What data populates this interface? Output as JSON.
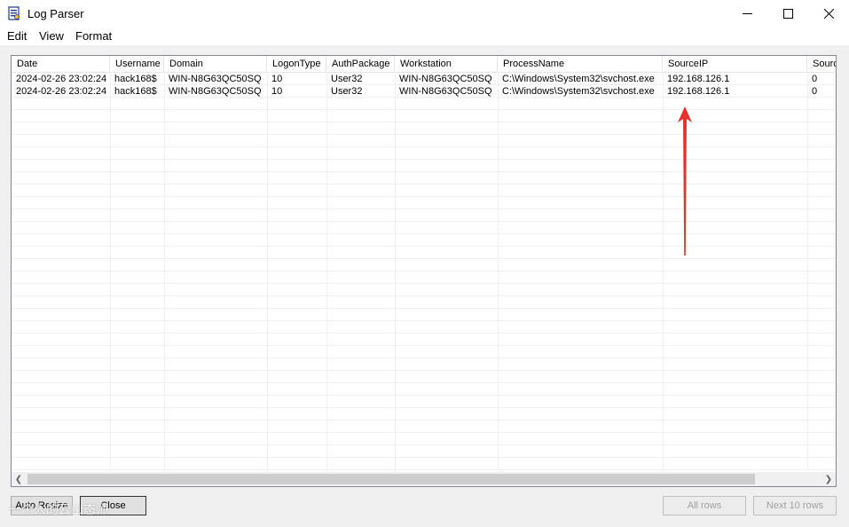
{
  "window": {
    "title": "Log Parser",
    "controls": {
      "minimize": "minimize-icon",
      "maximize": "maximize-icon",
      "close": "close-icon"
    }
  },
  "menu": [
    "Edit",
    "View",
    "Format"
  ],
  "table": {
    "columns": [
      "Date",
      "Username",
      "Domain",
      "LogonType",
      "AuthPackage",
      "Workstation",
      "ProcessName",
      "SourceIP",
      "Sourc"
    ],
    "rows": [
      [
        "2024-02-26 23:02:24",
        "hack168$",
        "WIN-N8G63QC50SQ",
        "10",
        "User32",
        "WIN-N8G63QC50SQ",
        "C:\\Windows\\System32\\svchost.exe",
        "192.168.126.1",
        "0"
      ],
      [
        "2024-02-26 23:02:24",
        "hack168$",
        "WIN-N8G63QC50SQ",
        "10",
        "User32",
        "WIN-N8G63QC50SQ",
        "C:\\Windows\\System32\\svchost.exe",
        "192.168.126.1",
        "0"
      ]
    ]
  },
  "buttons": {
    "auto_resize": "Auto Resize",
    "close": "Close",
    "all_rows": "All rows",
    "next_rows": "Next 10 rows"
  },
  "annotation": {
    "color": "#e8312a"
  },
  "watermark": "一个人的云山态师"
}
